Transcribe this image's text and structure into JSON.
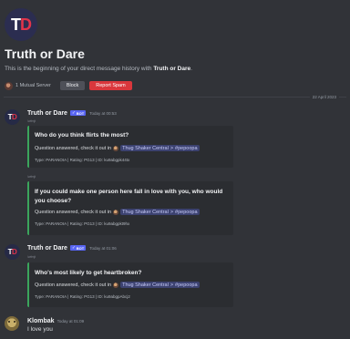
{
  "intro": {
    "avatar_letter_1": "T",
    "avatar_letter_2": "D",
    "title": "Truth or Dare",
    "subtitle_prefix": "This is the beginning of your direct message history with ",
    "subtitle_name": "Truth or Dare",
    "subtitle_suffix": ".",
    "mutual_servers": "1 Mutual Server",
    "block_label": "Block",
    "report_label": "Report Spam"
  },
  "date_divider": "22 April 2023",
  "messages": [
    {
      "author": "Truth or Dare",
      "bot_tag": "BOT",
      "check": "✓",
      "timestamp": "Today at 00:53",
      "reply_meta": "/wfmjt",
      "embed": {
        "title": "Who do you think flirts the most?",
        "answered_text": "Question answered, check it out in",
        "server": "Thug Shaker Central",
        "chevron": ">",
        "channel": "#pepoopa",
        "footer": "Type: PARANOIA | Rating: PG13 | ID: ku9abgpk44tx"
      }
    },
    {
      "reply_meta": "/wfmjt",
      "embed": {
        "title": "If you could make one person here fall in love with you, who would you choose?",
        "answered_text": "Question answered, check it out in",
        "server": "Thug Shaker Central",
        "chevron": ">",
        "channel": "#pepoopa",
        "footer": "Type: PARANOIA | Rating: PG13 | ID: ku9abgpkt9hx"
      }
    },
    {
      "author": "Truth or Dare",
      "bot_tag": "BOT",
      "check": "✓",
      "timestamp": "Today at 01:06",
      "reply_meta": "/wfmjt",
      "embed": {
        "title": "Who's most likely to get heartbroken?",
        "answered_text": "Question answered, check it out in",
        "server": "Thug Shaker Central",
        "chevron": ">",
        "channel": "#pepoopa",
        "footer": "Type: PARANOIA | Rating: PG13 | ID: ku9abgpAbcj2"
      }
    },
    {
      "author": "Klombak",
      "timestamp": "Today at 01:09",
      "text": "I love you"
    }
  ],
  "colors": {
    "background": "#313338",
    "embed_background": "#2b2d31",
    "embed_accent": "#3ba55c",
    "report_button": "#da373c",
    "block_button": "#4e5058",
    "bot_tag": "#5865f2",
    "logo_red": "#e0344a"
  }
}
